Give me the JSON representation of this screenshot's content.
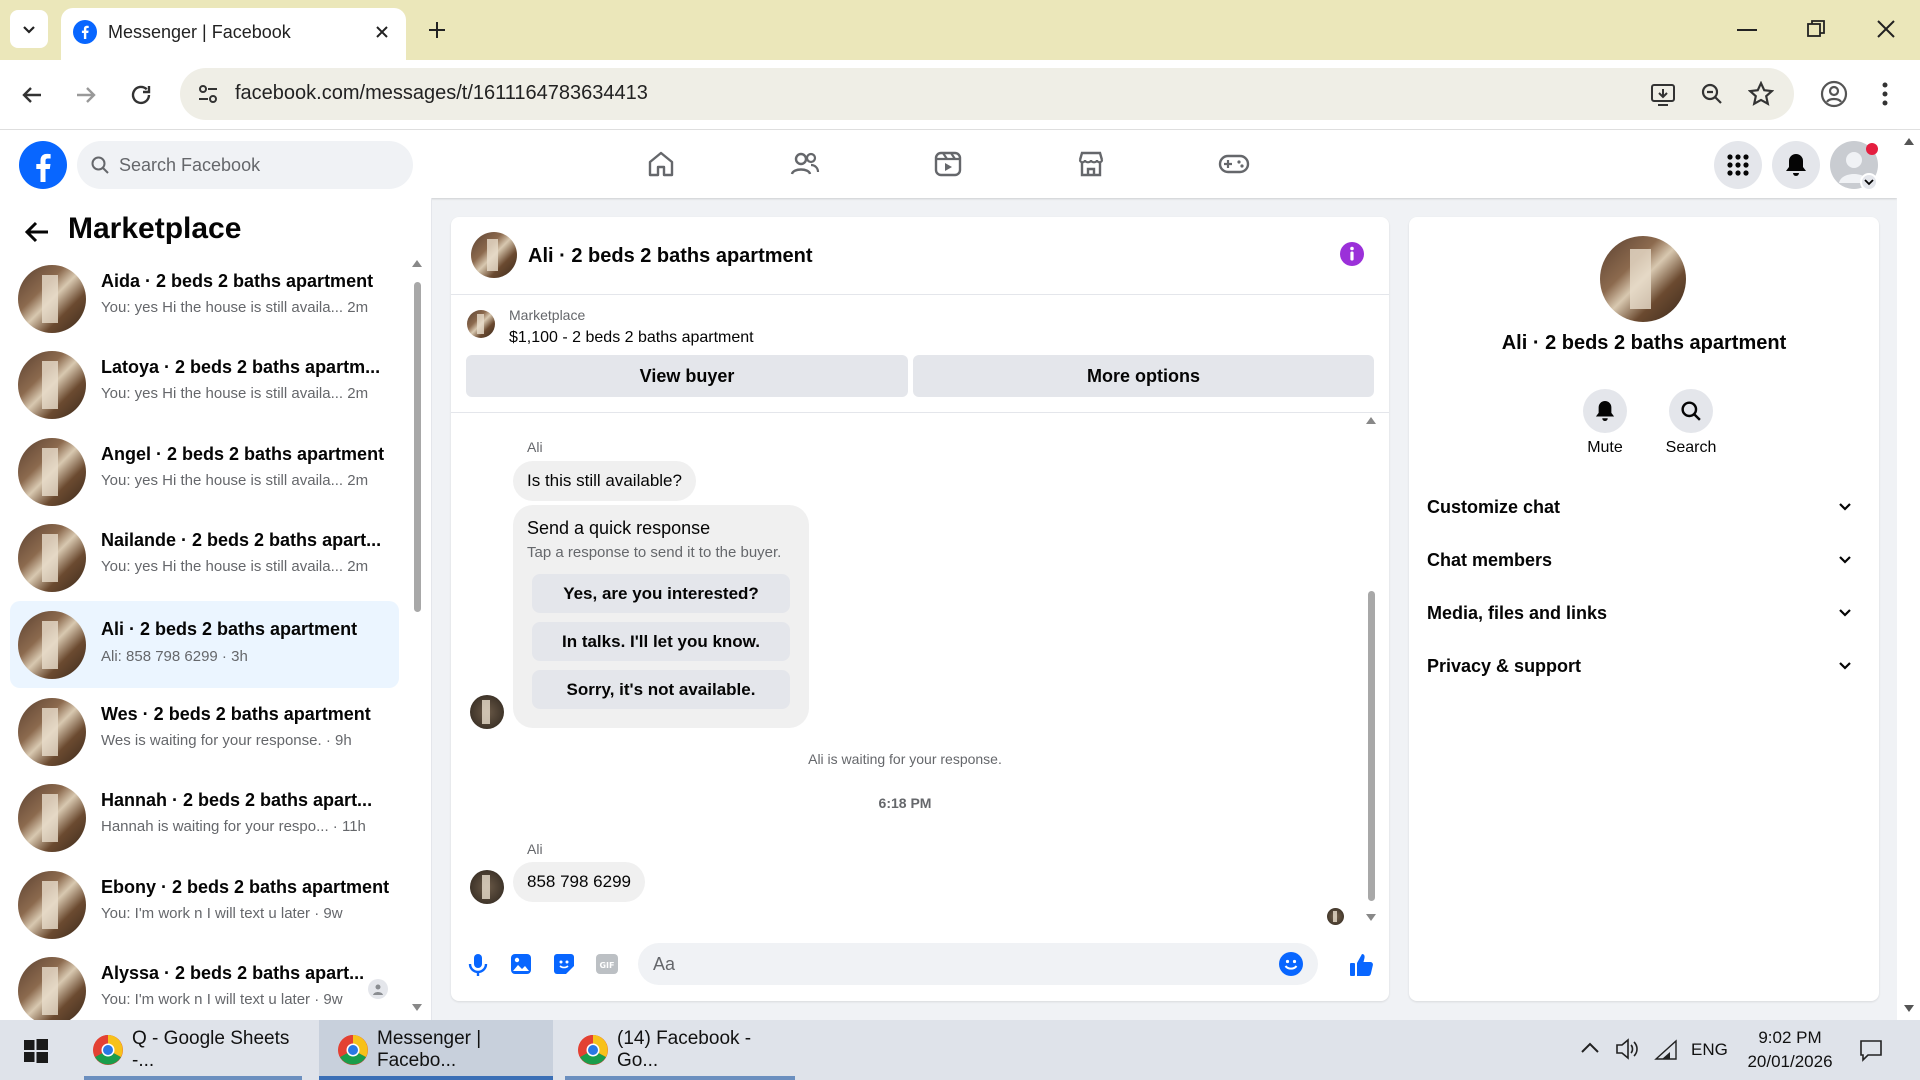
{
  "browser": {
    "tab_title": "Messenger | Facebook",
    "url": "facebook.com/messages/t/1611164783634413"
  },
  "fb": {
    "search_placeholder": "Search Facebook"
  },
  "left": {
    "title": "Marketplace",
    "conversations": [
      {
        "name": "Aida · 2 beds 2 baths apartment",
        "snippet": "You: yes Hi the house is still availa...",
        "time": "2m"
      },
      {
        "name": "Latoya · 2 beds 2 baths apartm...",
        "snippet": "You: yes Hi the house is still availa...",
        "time": "2m"
      },
      {
        "name": "Angel · 2 beds 2 baths apartment",
        "snippet": "You: yes Hi the house is still availa...",
        "time": "2m"
      },
      {
        "name": "Nailande · 2 beds 2 baths apart...",
        "snippet": "You: yes Hi the house is still availa...",
        "time": "2m"
      },
      {
        "name": "Ali · 2 beds 2 baths apartment",
        "snippet": "Ali: 858 798 6299",
        "time": "3h"
      },
      {
        "name": "Wes · 2 beds 2 baths apartment",
        "snippet": "Wes is waiting for your response.",
        "time": "9h"
      },
      {
        "name": "Hannah · 2 beds 2 baths apart...",
        "snippet": "Hannah is waiting for your respo...",
        "time": "11h"
      },
      {
        "name": "Ebony · 2 beds 2 baths apartment",
        "snippet": "You: I'm work n I will text u later",
        "time": "9w"
      },
      {
        "name": "Alyssa · 2 beds 2 baths apart...",
        "snippet": "You: I'm work n I will text u later",
        "time": "9w"
      }
    ]
  },
  "chat": {
    "title": "Ali · 2 beds 2 baths apartment",
    "listing_source": "Marketplace",
    "listing_title": "$1,100 - 2 beds 2 baths apartment",
    "view_buyer": "View buyer",
    "more_options": "More options",
    "sender": "Ali",
    "msg1": "Is this still available?",
    "quick_title": "Send a quick response",
    "quick_sub": "Tap a response to send it to the buyer.",
    "quick_options": [
      "Yes, are you interested?",
      "In talks. I'll let you know.",
      "Sorry, it's not available."
    ],
    "waiting": "Ali is waiting for your response.",
    "timestamp": "6:18 PM",
    "sender2": "Ali",
    "msg2": "858 798 6299",
    "composer_placeholder": "Aa"
  },
  "right": {
    "title": "Ali · 2 beds 2 baths apartment",
    "mute": "Mute",
    "search": "Search",
    "sections": [
      "Customize chat",
      "Chat members",
      "Media, files and links",
      "Privacy & support"
    ]
  },
  "taskbar": {
    "items": [
      "Q - Google Sheets -...",
      "Messenger | Facebo...",
      "(14) Facebook - Go..."
    ],
    "lang": "ENG",
    "time": "9:02 PM",
    "date": "20/01/2026"
  },
  "colors": {
    "accent": "#0866ff",
    "info_purple": "#9b30d9"
  }
}
